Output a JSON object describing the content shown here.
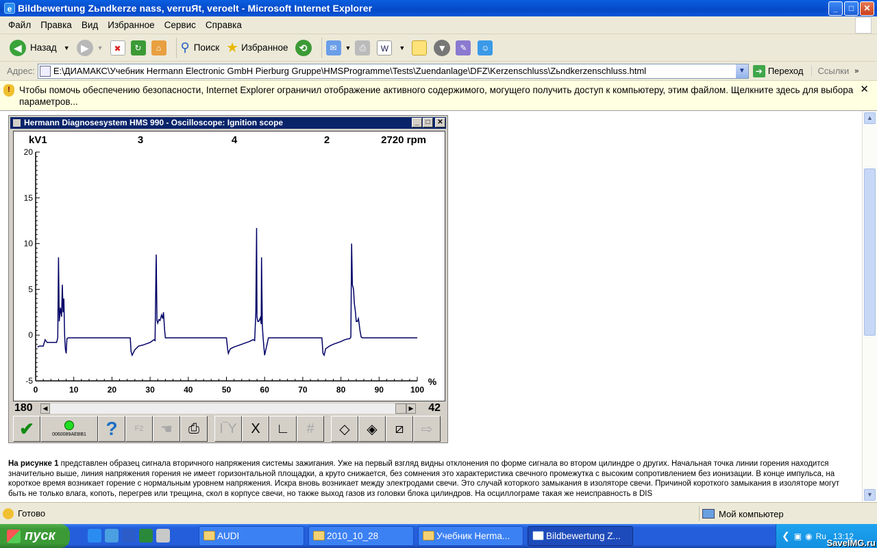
{
  "window": {
    "title": "Bildbewertung Zьndkerze nass, verruЯt, veroelt - Microsoft Internet Explorer"
  },
  "menu": [
    "Файл",
    "Правка",
    "Вид",
    "Избранное",
    "Сервис",
    "Справка"
  ],
  "toolbar": {
    "back_label": "Назад",
    "search_label": "Поиск",
    "favorites_label": "Избранное"
  },
  "address": {
    "label": "Адрес:",
    "url": "E:\\ДИАМАКС\\Учебник Hermann Electronic GmbH Pierburg Gruppe\\HMSProgramme\\Tests\\Zuendanlage\\DFZ\\Kerzenschluss\\Zьndkerzenschluss.html",
    "go_label": "Переход",
    "links_label": "Ссылки"
  },
  "infobar": {
    "text": "Чтобы помочь обеспечению безопасности, Internet Explorer ограничил отображение активного содержимого, могущего получить доступ к компьютеру, этим файлом. Щелкните здесь для выбора параметров..."
  },
  "oscilloscope": {
    "title": "Hermann Diagnosesystem HMS 990 - Oscilloscope: Ignition scope",
    "unit_label": "kV1",
    "cylinder_labels": [
      "3",
      "4",
      "2"
    ],
    "rpm": "2720 rpm",
    "x_unit": "%",
    "scroll_left_value": "180",
    "scroll_right_value": "42",
    "device_id": "0060089AEBB1",
    "f2_label": "F2"
  },
  "chart_data": {
    "type": "line",
    "title": "",
    "xlabel": "%",
    "ylabel": "kV1",
    "xlim": [
      0,
      100
    ],
    "ylim": [
      -5,
      20
    ],
    "x_ticks": [
      "0",
      "10",
      "20",
      "30",
      "40",
      "50",
      "60",
      "70",
      "80",
      "90",
      "100"
    ],
    "y_ticks": [
      "20",
      "15",
      "10",
      "5",
      "0",
      "-5"
    ],
    "grid": false,
    "series": [
      {
        "color": "#000066",
        "x": [
          0.5,
          1,
          2,
          2.5,
          3,
          5.5,
          5.8,
          6,
          6.2,
          6.5,
          6.8,
          7,
          7.2,
          7.4,
          7.6,
          7.8,
          8,
          8.2,
          8.5,
          9,
          12,
          20,
          24.8,
          25,
          25.3,
          26,
          27,
          28,
          30,
          31,
          31.3,
          31.6,
          31.8,
          32,
          32.3,
          32.6,
          33,
          33.3,
          33.5,
          33.8,
          34,
          35,
          40,
          50,
          50.3,
          50.5,
          51,
          52,
          54,
          56,
          57,
          57.4,
          57.7,
          57.9,
          58,
          58.2,
          58.5,
          58.9,
          59.1,
          59.2,
          59.4,
          59.6,
          60,
          61,
          61.5,
          62,
          65,
          70,
          75,
          75.3,
          75.6,
          76,
          77,
          78,
          80,
          81,
          82,
          82.3,
          82.6,
          82.8,
          83,
          83.3,
          83.5,
          83.8,
          84,
          84.3,
          84.6,
          85,
          85.3,
          85.6,
          86,
          90,
          100
        ],
        "y": [
          -1.3,
          -1.2,
          -1.2,
          -0.5,
          -0.8,
          -0.8,
          -0.3,
          8.5,
          1.5,
          3,
          2,
          5.5,
          2.5,
          4,
          0,
          -1.5,
          -2,
          -0.4,
          -0.3,
          -0.3,
          -0.3,
          -0.3,
          -0.3,
          -1.8,
          -2.2,
          -1.6,
          -1.2,
          -1.1,
          -0.8,
          -0.5,
          -0.6,
          8.8,
          1.6,
          1.3,
          1.7,
          1.6,
          2.2,
          1.8,
          2.5,
          0.5,
          -0.3,
          -0.3,
          -0.3,
          -0.3,
          -1.5,
          -2,
          -1.5,
          -1.3,
          -1,
          -0.7,
          -0.5,
          -0.6,
          2.5,
          11.7,
          2,
          1.5,
          1.5,
          1.9,
          1.2,
          8.5,
          1,
          -0.3,
          -2.2,
          -0.3,
          -0.3,
          -0.3,
          -0.3,
          -0.3,
          -0.3,
          -2,
          -2.2,
          -1.5,
          -1.2,
          -1,
          -0.7,
          -0.5,
          -0.4,
          -0.4,
          -0.2,
          10,
          5.5,
          5,
          3.5,
          2.5,
          1.5,
          1.5,
          1.8,
          0.5,
          -0.2,
          -0.3,
          -0.3,
          -0.3,
          -0.3
        ]
      }
    ]
  },
  "description": {
    "bold_lead": "На рисунке 1",
    "text": " представлен образец сигнала вторичного напряжения системы зажигания. Уже на первый взгляд видны отклонения по форме сигнала во втором цилиндре о других. Начальная точка линии горения находится значительно выше, линия напряжения горения не имеет горизонтальной площадки, а круто снижается, без сомнения это характеристика свечного промежутка с высоким сопротивлением без ионизации. В конце импульса, на короткое время возникает горение с нормальным уровнем напряжения. Искра вновь возникает между электродами свечи. Это случай которкого замыкания в изоляторе свечи. Причиной короткого замыкания в изоляторе могут быть не только влага, копоть, перегрев или трещина, скол в корпусе свечи, но также выход газов из головки блока цилиндров. На осциллограме такая же неисправность в DIS"
  },
  "status": {
    "left": "Готово",
    "zone": "Мой компьютер"
  },
  "taskbar": {
    "start_label": "пуск",
    "tasks": [
      "AUDI",
      "2010_10_28",
      "Учебник Herma...",
      "Bildbewertung Z..."
    ],
    "lang": "Ru",
    "clock": "13:12",
    "watermark": "SaveIMG.ru"
  }
}
